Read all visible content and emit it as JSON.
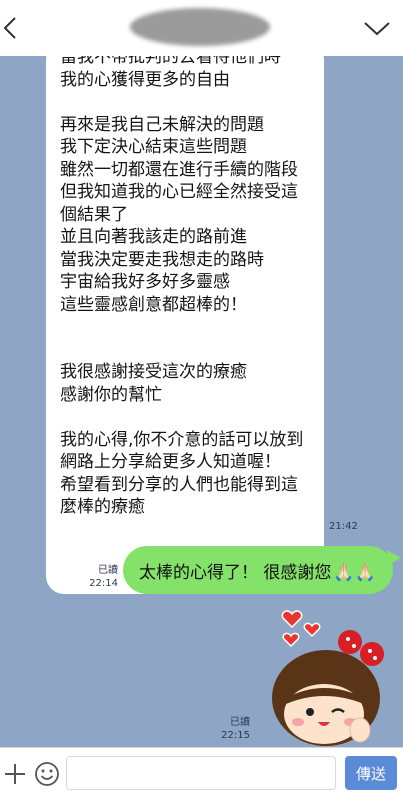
{
  "header": {
    "contact_name": "",
    "back_icon": "chevron-left-icon",
    "menu_icon": "chevron-down-icon"
  },
  "messages": [
    {
      "side": "left",
      "text": "當我不帶批判的去看待他們時\n我的心獲得更多的自由\n\n再來是我自己未解決的問題\n我下定決心結束這些問題\n雖然一切都還在進行手續的階段\n但我知道我的心已經全然接受這\n個結果了\n並且向著我該走的路前進\n當我決定要走我想走的路時\n宇宙給我好多好多靈感\n這些靈感創意都超棒的！\n\n\n我很感謝接受這次的療癒\n感謝你的幫忙\n\n我的心得,你不介意的話可以放到\n網路上分享給更多人知道喔！\n希望看到分享的人們也能得到這\n麼棒的療癒",
      "time": "21:42"
    },
    {
      "side": "right",
      "text": "太棒的心得了！ 很感謝您",
      "emoji": "🙏🏻🙏🏻",
      "read": "已讀",
      "time": "22:14"
    },
    {
      "side": "right",
      "sticker": "girl-hearts-sticker",
      "read": "已讀",
      "time": "22:15"
    }
  ],
  "footer": {
    "input_placeholder": "",
    "send_label": "傳送",
    "plus_icon": "plus-icon",
    "emoji_icon": "smiley-icon"
  },
  "colors": {
    "chat_background": "#8ea5c6",
    "outgoing_bubble": "#84e26a",
    "incoming_bubble": "#ffffff",
    "send_button": "#5b8bd6"
  }
}
